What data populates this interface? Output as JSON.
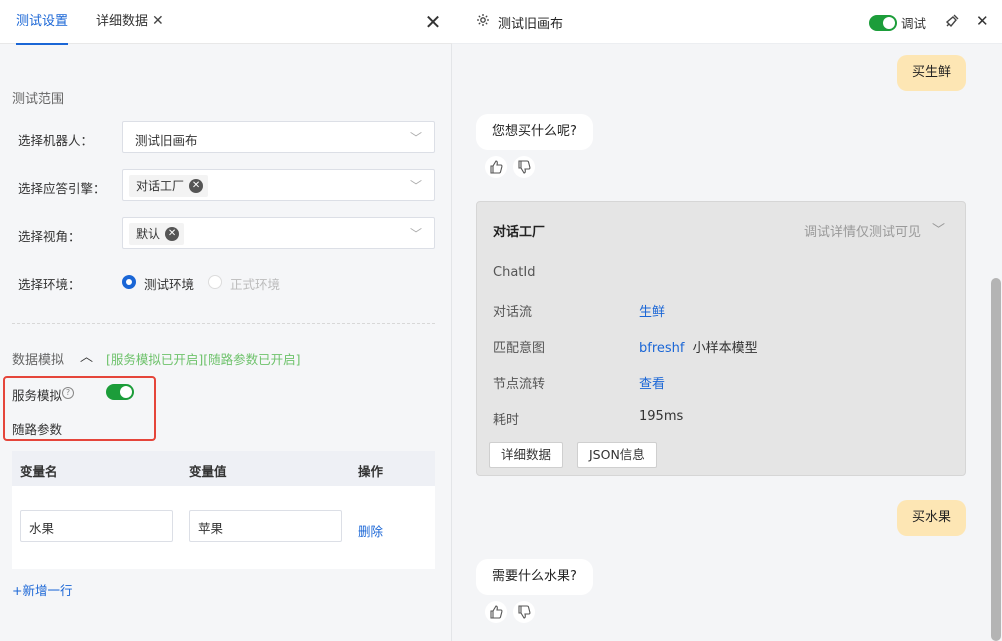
{
  "left": {
    "tabs": [
      {
        "label": "测试设置",
        "active": true
      },
      {
        "label": "详细数据",
        "active": false
      }
    ],
    "scope_title": "测试范围",
    "form": {
      "robot_label": "选择机器人：",
      "robot_value": "测试旧画布",
      "engine_label": "选择应答引擎：",
      "engine_tag": "对话工厂",
      "view_label": "选择视角：",
      "view_tag": "默认",
      "env_label": "选择环境：",
      "env_options": [
        {
          "label": "测试环境",
          "selected": true
        },
        {
          "label": "正式环境",
          "selected": false,
          "disabled": true
        }
      ]
    },
    "data_mock": {
      "title": "数据模拟",
      "status": "[服务模拟已开启][随路参数已开启]",
      "service_mock_label": "服务模拟",
      "service_mock_on": true,
      "route_params_label": "随路参数"
    },
    "table": {
      "headers": [
        "变量名",
        "变量值",
        "操作"
      ],
      "rows": [
        {
          "name": "水果",
          "value": "苹果",
          "action": "删除"
        }
      ]
    },
    "add_row": "+新增一行"
  },
  "right": {
    "title": "测试旧画布",
    "debug_label": "调试",
    "debug_on": true,
    "messages": {
      "user1": "买生鲜",
      "bot1": "您想买什么呢?",
      "user2": "买水果",
      "bot2": "需要什么水果?"
    },
    "debug_card": {
      "title": "对话工厂",
      "hint": "调试详情仅测试可见",
      "rows": {
        "chatid_label": "ChatId",
        "flow_label": "对话流",
        "flow_value": "生鲜",
        "intent_label": "匹配意图",
        "intent_value": "bfreshf",
        "intent_model": "小样本模型",
        "node_label": "节点流转",
        "node_value": "查看",
        "time_label": "耗时",
        "time_value": "195ms"
      },
      "buttons": {
        "detail": "详细数据",
        "json": "JSON信息"
      }
    }
  },
  "colors": {
    "accent_blue": "#1a66d6",
    "toggle_green": "#1c9d3a",
    "status_green": "#6ec26b",
    "highlight_red": "#e5453a",
    "user_bubble": "#fde6b4"
  }
}
